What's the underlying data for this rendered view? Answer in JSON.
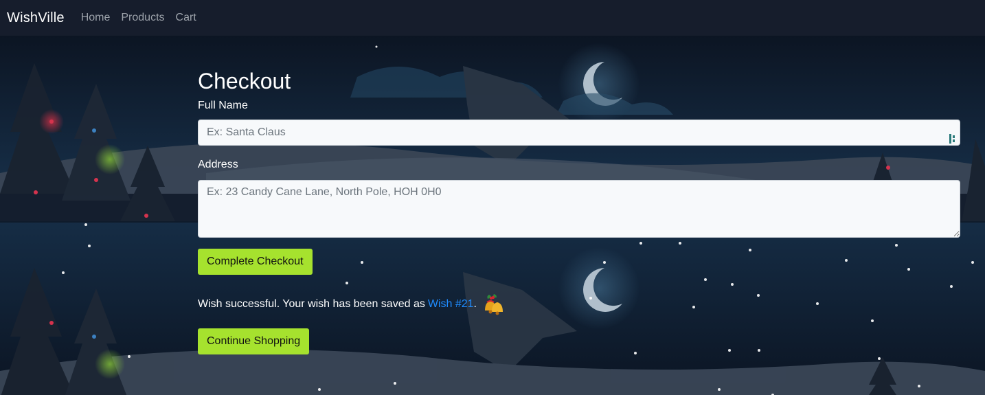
{
  "navbar": {
    "brand": "WishVille",
    "links": [
      "Home",
      "Products",
      "Cart"
    ]
  },
  "checkout": {
    "title": "Checkout",
    "full_name_label": "Full Name",
    "full_name_placeholder": "Ex: Santa Claus",
    "address_label": "Address",
    "address_placeholder": "Ex: 23 Candy Cane Lane, North Pole, HOH 0H0",
    "complete_button": "Complete Checkout",
    "status_prefix": "Wish successful. Your wish has been saved as",
    "wish_link": "Wish #21",
    "status_suffix": ".",
    "continue_button": "Continue Shopping"
  },
  "icons": {
    "autofill": "autofill-icon",
    "bells": "christmas-bells-icon"
  },
  "colors": {
    "navbar_bg": "#161d2c",
    "button_green": "#a6e22e",
    "link_blue": "#1f8cff",
    "input_bg": "#f7f9fb"
  }
}
